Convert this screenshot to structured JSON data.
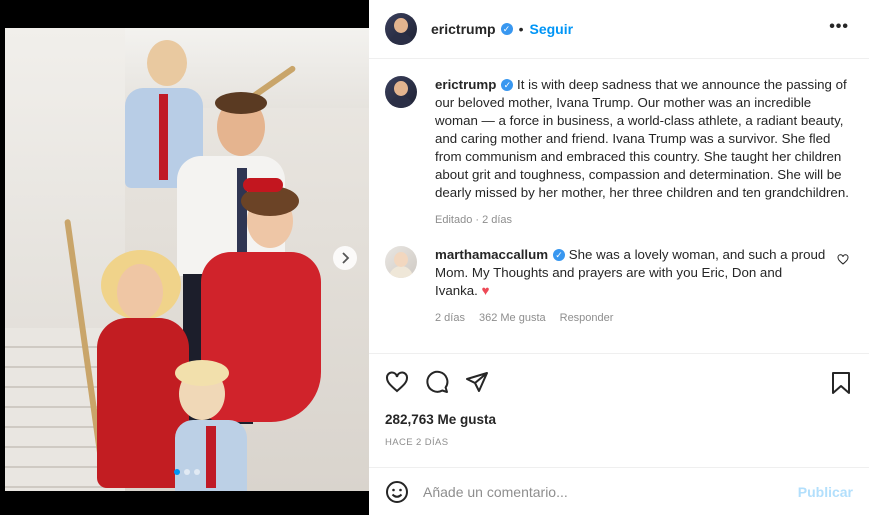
{
  "post": {
    "username": "erictrump",
    "follow_label": "Seguir",
    "dot_separator": "•",
    "more_label": "•••"
  },
  "caption": {
    "username": "erictrump",
    "text": "It is with deep sadness that we announce the passing of our beloved mother, Ivana Trump. Our mother was an incredible woman — a force in business, a world-class athlete, a radiant beauty, and caring mother and friend. Ivana Trump was a survivor. She fled from communism and embraced this country. She taught her children about grit and toughness, compassion and determination. She will be dearly missed by her mother, her three children and ten grandchildren.",
    "meta": "Editado · 2 días"
  },
  "comments": [
    {
      "username": "marthamaccallum",
      "text": "She was a lovely woman, and such a proud Mom. My Thoughts and prayers are with you Eric, Don and Ivanka.",
      "emoji": "♥",
      "time": "2 días",
      "likes": "362 Me gusta",
      "reply": "Responder"
    }
  ],
  "actions": {
    "likes": "282,763 Me gusta",
    "when": "HACE 2 DÍAS"
  },
  "add_comment": {
    "placeholder": "Añade un comentario...",
    "publish": "Publicar"
  },
  "icons": {
    "verified": "verified-badge-icon",
    "like": "heart-icon",
    "comment": "comment-icon",
    "share": "paper-plane-icon",
    "save": "bookmark-icon",
    "emoji": "smiley-icon",
    "next": "chevron-right-icon"
  },
  "colors": {
    "accent": "#0095f6",
    "verified": "#3897f0",
    "publish_disabled": "#b2dffc",
    "heart": "#ed4956"
  }
}
